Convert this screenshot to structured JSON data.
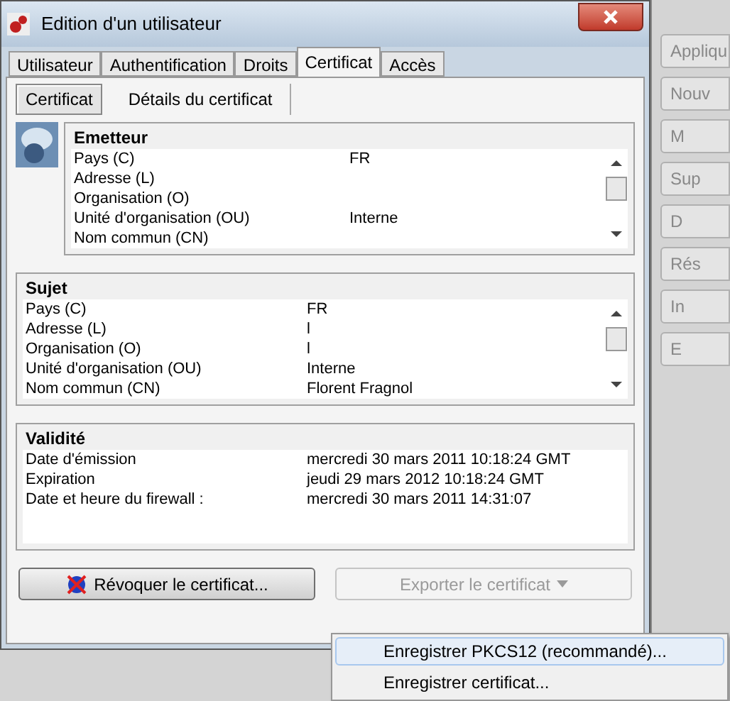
{
  "window": {
    "title": "Edition d'un utilisateur"
  },
  "tabs": [
    {
      "label": "Utilisateur",
      "selected": false
    },
    {
      "label": "Authentification",
      "selected": false
    },
    {
      "label": "Droits",
      "selected": false
    },
    {
      "label": "Certificat",
      "selected": true
    },
    {
      "label": "Accès",
      "selected": false
    }
  ],
  "subtabs": [
    {
      "label": "Certificat",
      "selected": true
    },
    {
      "label": "Détails du certificat",
      "selected": false
    }
  ],
  "sections": [
    {
      "title": "Emetteur",
      "rows": [
        {
          "field": "Pays (C)",
          "value": "FR"
        },
        {
          "field": "Adresse (L)"
        },
        {
          "field": "Organisation (O)"
        },
        {
          "field": "Unité d'organisation (OU)",
          "value": "Interne"
        },
        {
          "field": "Nom commun (CN)"
        }
      ],
      "scrollable": true,
      "icon": true
    },
    {
      "title": "Sujet",
      "rows": [
        {
          "field": "Pays (C)",
          "value": "FR"
        },
        {
          "field": "Adresse (L)",
          "value": "l"
        },
        {
          "field": "Organisation (O)",
          "value": "l"
        },
        {
          "field": "Unité d'organisation (OU)",
          "value": "Interne"
        },
        {
          "field": "Nom commun (CN)",
          "value": "Florent Fragnol"
        }
      ],
      "scrollable": true,
      "icon": false
    },
    {
      "title": "Validité",
      "rows": [
        {
          "field": "Date d'émission",
          "value": "mercredi 30 mars 2011 10:18:24 GMT"
        },
        {
          "field": "Expiration",
          "value": "jeudi 29 mars 2012 10:18:24 GMT"
        },
        {
          "field": "Date et heure du firewall :",
          "value": "mercredi 30 mars 2011 14:31:07"
        }
      ],
      "scrollable": false,
      "icon": false
    }
  ],
  "buttons": [
    {
      "label": "Révoquer le certificat...",
      "disabled": false
    },
    {
      "label": "Exporter le certificat",
      "disabled": true
    }
  ],
  "export_menu": [
    {
      "label": "Enregistrer PKCS12 (recommandé)...",
      "selected": true
    },
    {
      "label": "Enregistrer certificat...",
      "selected": false
    }
  ],
  "background_buttons": [
    "Appliqu",
    "Nouv",
    "M",
    "Sup",
    "D",
    "Rés",
    "In",
    "E"
  ]
}
